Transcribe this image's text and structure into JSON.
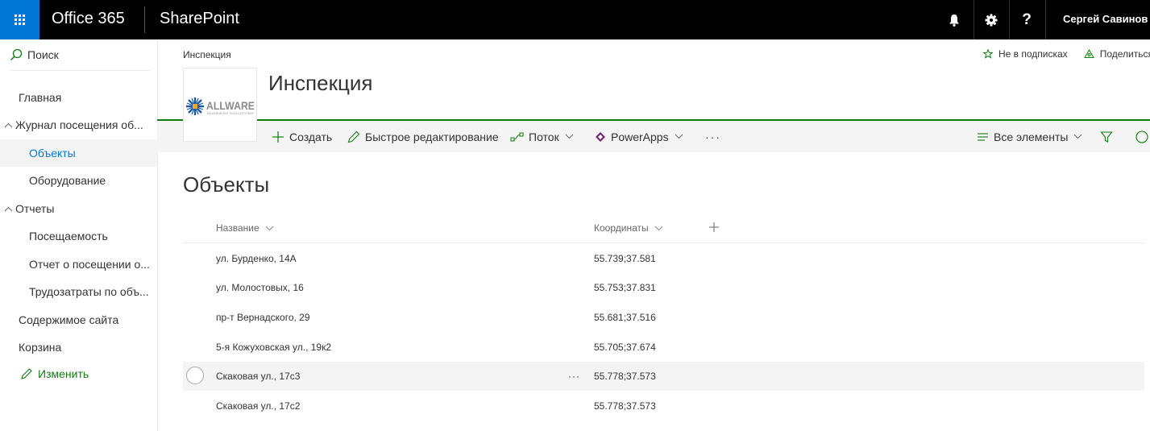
{
  "suite": {
    "brand": "Office 365",
    "app": "SharePoint",
    "user": "Сергей Савинов",
    "help_glyph": "?"
  },
  "nav": {
    "search": "Поиск",
    "items": [
      {
        "label": "Главная"
      },
      {
        "label": "Журнал посещения об..."
      },
      {
        "label": "Объекты"
      },
      {
        "label": "Оборудование"
      },
      {
        "label": "Отчеты"
      },
      {
        "label": "Посещаемость"
      },
      {
        "label": "Отчет о посещении о..."
      },
      {
        "label": "Трудозатраты по объ..."
      },
      {
        "label": "Содержимое сайта"
      },
      {
        "label": "Корзина"
      }
    ],
    "edit": "Изменить"
  },
  "site": {
    "breadcrumb": "Инспекция",
    "title": "Инспекция",
    "follow": "Не в подписках",
    "share": "Поделиться",
    "logo_text": "ALLWARE",
    "logo_subtext": "BUSINESS SOLUTIONS"
  },
  "commands": {
    "new": "Создать",
    "quick_edit": "Быстрое редактирование",
    "flow": "Поток",
    "powerapps": "PowerApps",
    "more": "···",
    "view": "Все элементы"
  },
  "list": {
    "title": "Объекты",
    "columns": [
      "Название",
      "Координаты"
    ],
    "rows": [
      {
        "name": "ул. Бурденко, 14А",
        "coords": "55.739;37.581"
      },
      {
        "name": "ул. Молостовых, 16",
        "coords": "55.753;37.831"
      },
      {
        "name": "пр-т Вернадского, 29",
        "coords": "55.681;37.516"
      },
      {
        "name": "5-я Кожуховская ул., 19к2",
        "coords": "55.705;37.674"
      },
      {
        "name": "Скаковая ул., 17с3",
        "coords": "55.778;37.573"
      },
      {
        "name": "Скаковая ул., 17с2",
        "coords": "55.778;37.573"
      }
    ],
    "row_more": "···"
  },
  "colors": {
    "suite_bg": "#000000",
    "waffle_bg": "#0078d7",
    "accent": "#0078d7",
    "site_accent": "#107c10",
    "powerapps": "#742774"
  }
}
